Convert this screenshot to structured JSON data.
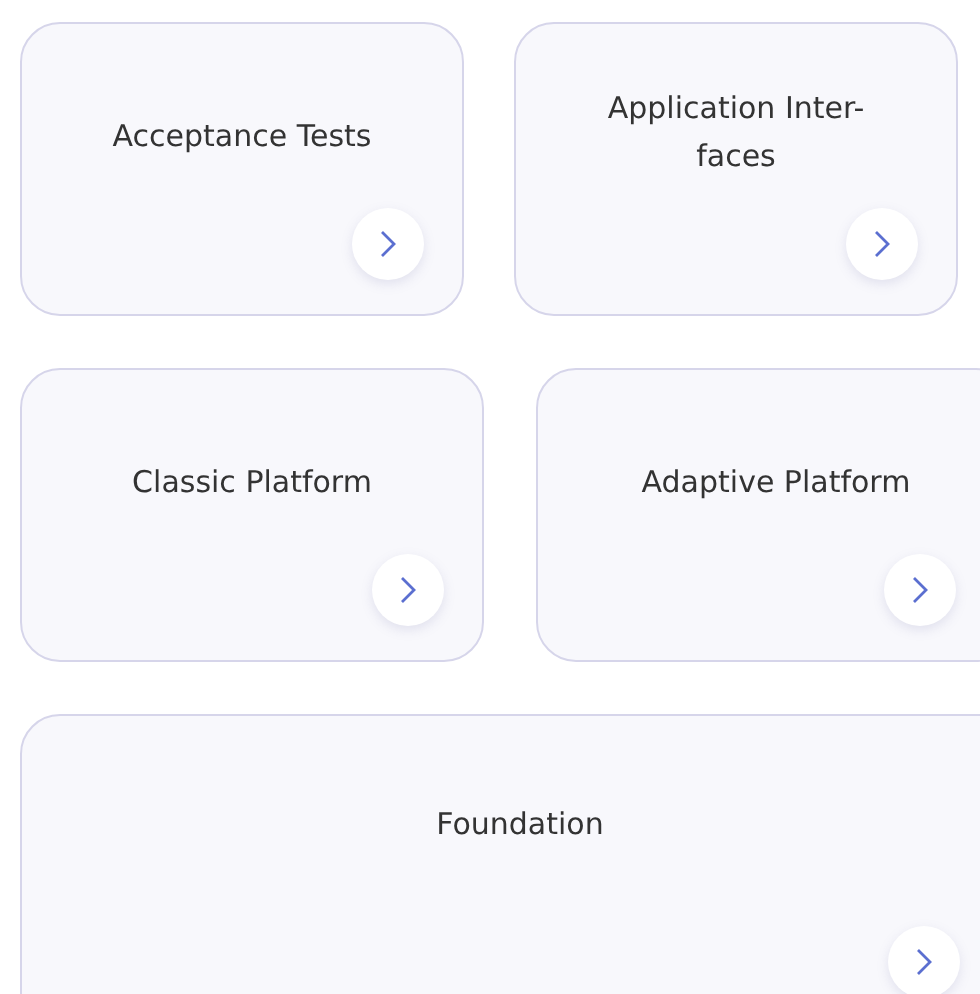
{
  "rows": [
    {
      "cards": [
        {
          "title": "Acceptance Tests"
        },
        {
          "title": "Application Inter-\nfaces"
        }
      ]
    },
    {
      "cards": [
        {
          "title": "Classic Platform"
        },
        {
          "title": "Adaptive Platform"
        }
      ]
    },
    {
      "cards": [
        {
          "title": "Foundation"
        }
      ]
    }
  ]
}
